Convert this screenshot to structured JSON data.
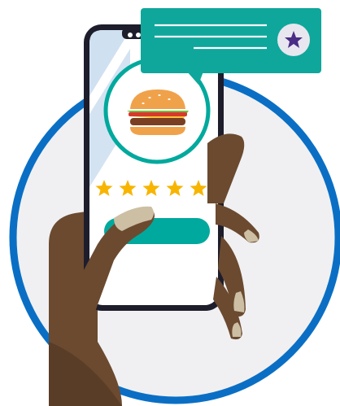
{
  "illustration": {
    "food_icon": "burger-icon",
    "rating": {
      "value": 5,
      "max": 5
    },
    "review_card": {
      "icon": "star-icon",
      "text_lines": 3
    },
    "phone": {
      "screen_button_label": ""
    }
  },
  "colors": {
    "circle_ring": "#0a6fc4",
    "circle_fill": "#f0f0f2",
    "teal": "#00a99d",
    "bubble": "#0fa79b",
    "phone_frame": "#1d1d2b",
    "screen": "#ffffff",
    "screen_tint": "#cfe0f1",
    "skin": "#6b4a30",
    "skin_shadow": "#5a3d27",
    "nail": "#cdbfa3",
    "star_gold": "#f7b500",
    "bubble_star": "#4a2d86"
  }
}
